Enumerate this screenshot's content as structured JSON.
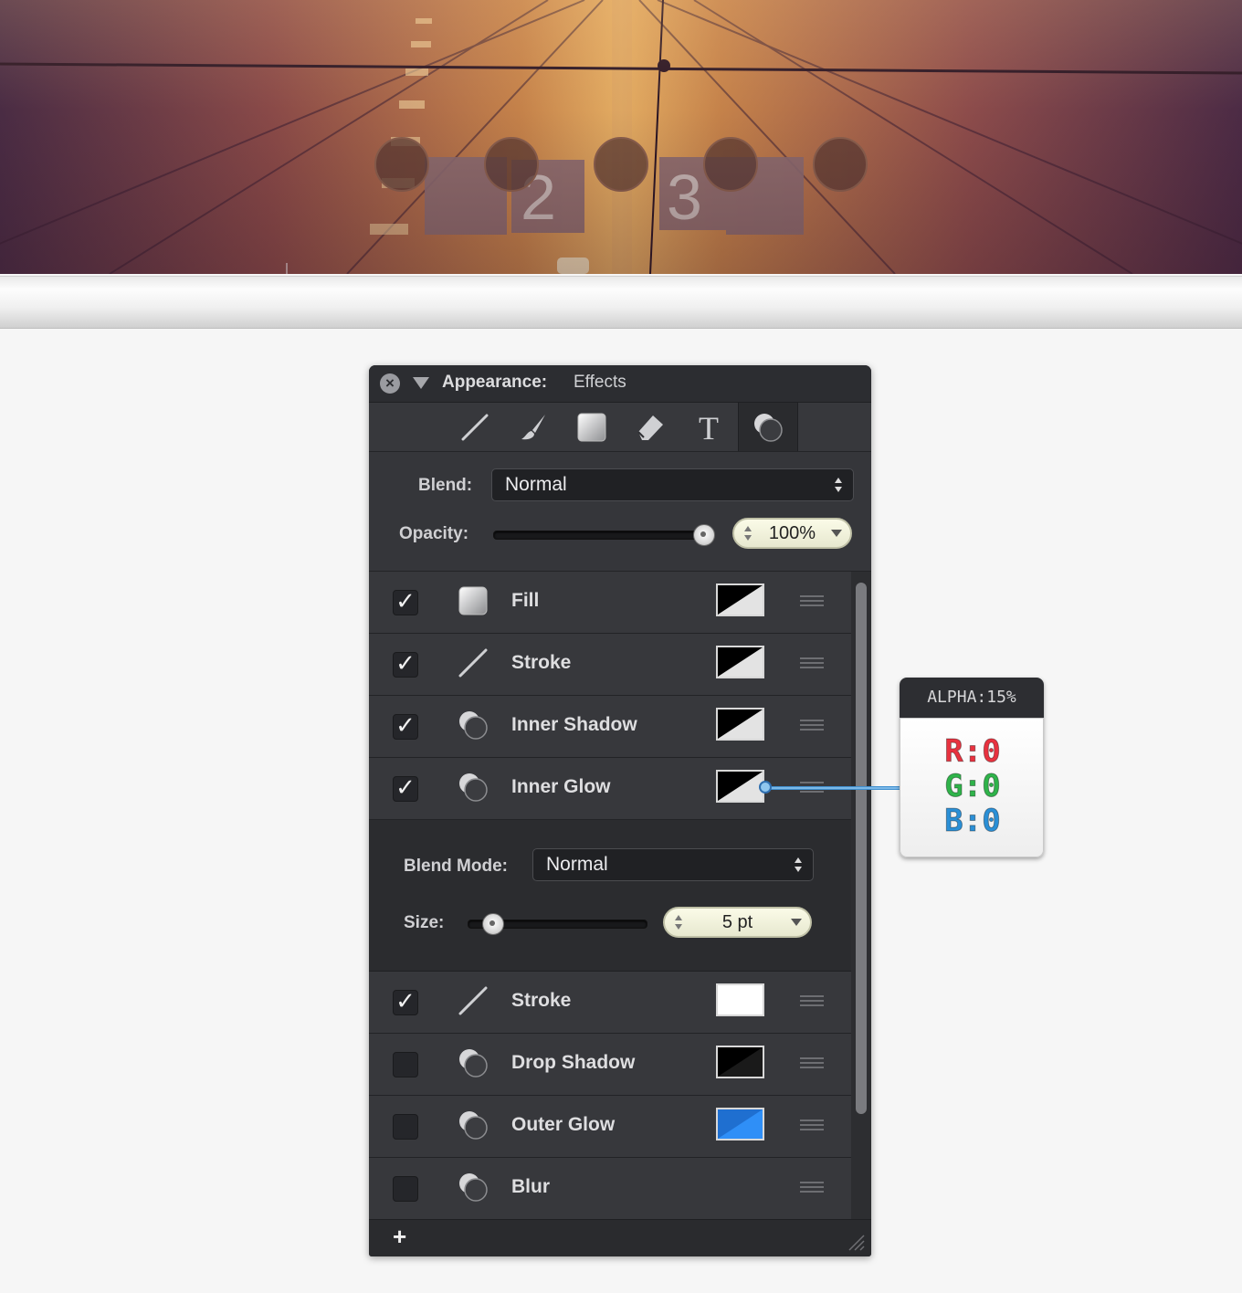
{
  "banner": {
    "sign_numbers": [
      "2",
      "3"
    ]
  },
  "panel": {
    "title": "Appearance:",
    "subtitle": "Effects",
    "close_icon": "close-icon",
    "tools": [
      "stroke-tool-icon",
      "brush-tool-icon",
      "fill-tool-icon",
      "eraser-tool-icon",
      "text-tool-icon",
      "effects-tool-icon"
    ],
    "selected_tool": "effects-tool-icon",
    "blend": {
      "label": "Blend:",
      "value": "Normal"
    },
    "opacity": {
      "label": "Opacity:",
      "value": "100%",
      "level": 1.0
    },
    "effects": [
      {
        "label": "Fill",
        "checked": true,
        "icon": "fill-icon",
        "swatch": "black-white"
      },
      {
        "label": "Stroke",
        "checked": true,
        "icon": "stroke-icon",
        "swatch": "black-white"
      },
      {
        "label": "Inner Shadow",
        "checked": true,
        "icon": "effect-icon",
        "swatch": "black-white"
      },
      {
        "label": "Inner Glow",
        "checked": true,
        "icon": "effect-icon",
        "swatch": "black-white"
      },
      {
        "label": "Stroke",
        "checked": true,
        "icon": "stroke-icon",
        "swatch": "white"
      },
      {
        "label": "Drop Shadow",
        "checked": false,
        "icon": "effect-icon",
        "swatch": "black"
      },
      {
        "label": "Outer Glow",
        "checked": false,
        "icon": "effect-icon",
        "swatch": "blue"
      },
      {
        "label": "Blur",
        "checked": false,
        "icon": "effect-icon",
        "swatch": ""
      }
    ],
    "inner_glow_settings": {
      "blend_mode_label": "Blend Mode:",
      "blend_mode_value": "Normal",
      "size_label": "Size:",
      "size_value": "5 pt",
      "size_level": 0.12
    },
    "add_label": "+"
  },
  "colors": {
    "panel_bg": "#2f3034",
    "swatch_blue": "#2f8ff7",
    "red": "#e8323f",
    "green": "#2fb34a",
    "blue": "#2a8fd6"
  },
  "tooltip": {
    "alpha": "ALPHA:15%",
    "r": "R:0",
    "g": "G:0",
    "b": "B:0"
  }
}
